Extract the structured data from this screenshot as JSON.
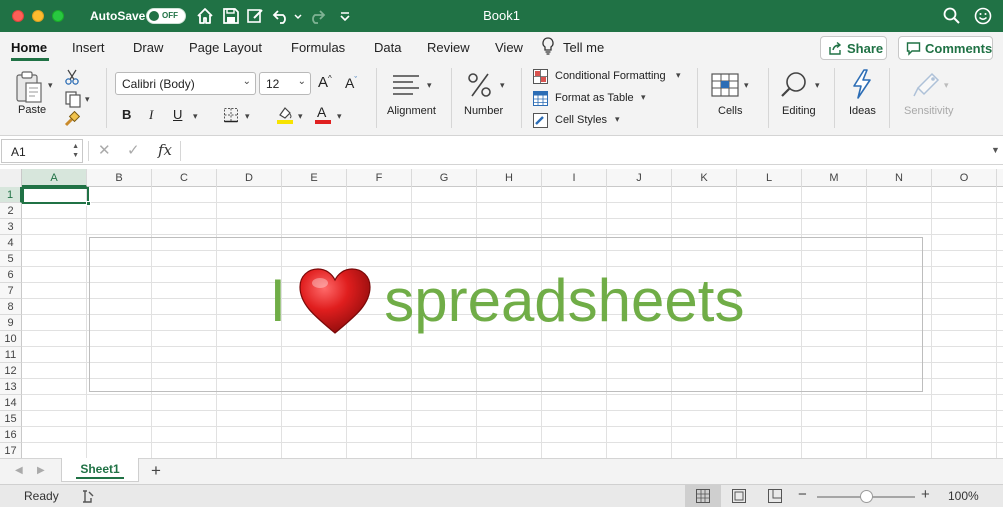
{
  "window": {
    "autosave_label": "AutoSave",
    "autosave_state": "OFF",
    "title": "Book1"
  },
  "tabs": [
    "Home",
    "Insert",
    "Draw",
    "Page Layout",
    "Formulas",
    "Data",
    "Review",
    "View"
  ],
  "tell_me": "Tell me",
  "share_label": "Share",
  "comments_label": "Comments",
  "ribbon": {
    "paste_label": "Paste",
    "font_name": "Calibri (Body)",
    "font_size": "12",
    "bold": "B",
    "italic": "I",
    "underline": "U",
    "grow_font": "A",
    "shrink_font": "A",
    "font_color_letter": "A",
    "alignment_label": "Alignment",
    "number_label": "Number",
    "conditional_formatting": "Conditional Formatting",
    "format_as_table": "Format as Table",
    "cell_styles": "Cell Styles",
    "cells_label": "Cells",
    "editing_label": "Editing",
    "ideas_label": "Ideas",
    "sensitivity_label": "Sensitivity",
    "highlight_color": "#f7e300",
    "font_color": "#e02020"
  },
  "formula_bar": {
    "name_box": "A1",
    "cancel_icon": "✕",
    "enter_icon": "✓",
    "fx_label": "fx",
    "value": ""
  },
  "columns": [
    "A",
    "B",
    "C",
    "D",
    "E",
    "F",
    "G",
    "H",
    "I",
    "J",
    "K",
    "L",
    "M",
    "N",
    "O"
  ],
  "rows": [
    "1",
    "2",
    "3",
    "4",
    "5",
    "6",
    "7",
    "8",
    "9",
    "10",
    "11",
    "12",
    "13",
    "14",
    "15",
    "16",
    "17"
  ],
  "selected_cell": {
    "column": "A",
    "row": "1"
  },
  "textbox": {
    "word_before": "I",
    "heart_icon": "heart-icon",
    "word_after": "spreadsheets",
    "text_color": "#70ad47",
    "heart_color": "#d21a1a"
  },
  "sheet_tab": "Sheet1",
  "add_sheet": "+",
  "status": {
    "ready": "Ready",
    "zoom": "100%",
    "zoom_minus": "−",
    "zoom_plus": "+"
  },
  "colors": {
    "accent": "#207245",
    "ribbon_bg": "#f3f3f3"
  }
}
